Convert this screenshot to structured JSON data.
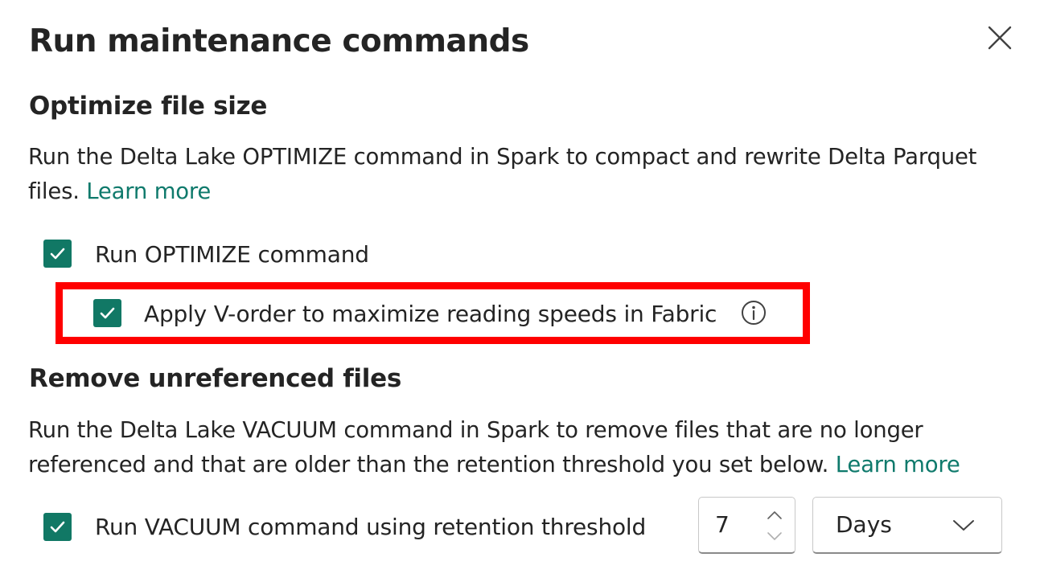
{
  "dialog": {
    "title": "Run maintenance commands",
    "close_label": "close"
  },
  "optimize": {
    "heading": "Optimize file size",
    "description": "Run the Delta Lake OPTIMIZE command in Spark to compact and rewrite Delta Parquet files.",
    "learn_more": "Learn more",
    "run_optimize": {
      "label": "Run OPTIMIZE command",
      "checked": true
    },
    "v_order": {
      "label": "Apply V-order to maximize reading speeds in Fabric",
      "checked": true
    }
  },
  "vacuum": {
    "heading": "Remove unreferenced files",
    "description": "Run the Delta Lake VACUUM command in Spark to remove files that are no longer referenced and that are older than the retention threshold you set below.",
    "learn_more": "Learn more",
    "run_vacuum": {
      "label": "Run VACUUM command using retention threshold",
      "checked": true
    },
    "retention_value": "7",
    "retention_unit": "Days"
  },
  "colors": {
    "accent": "#117865",
    "link": "#0f7a6c",
    "highlight": "#ff0000"
  },
  "icons": {
    "close": "close-icon",
    "check": "checkmark-icon",
    "info": "info-icon",
    "chevron_up": "chevron-up-icon",
    "chevron_down": "chevron-down-icon"
  }
}
